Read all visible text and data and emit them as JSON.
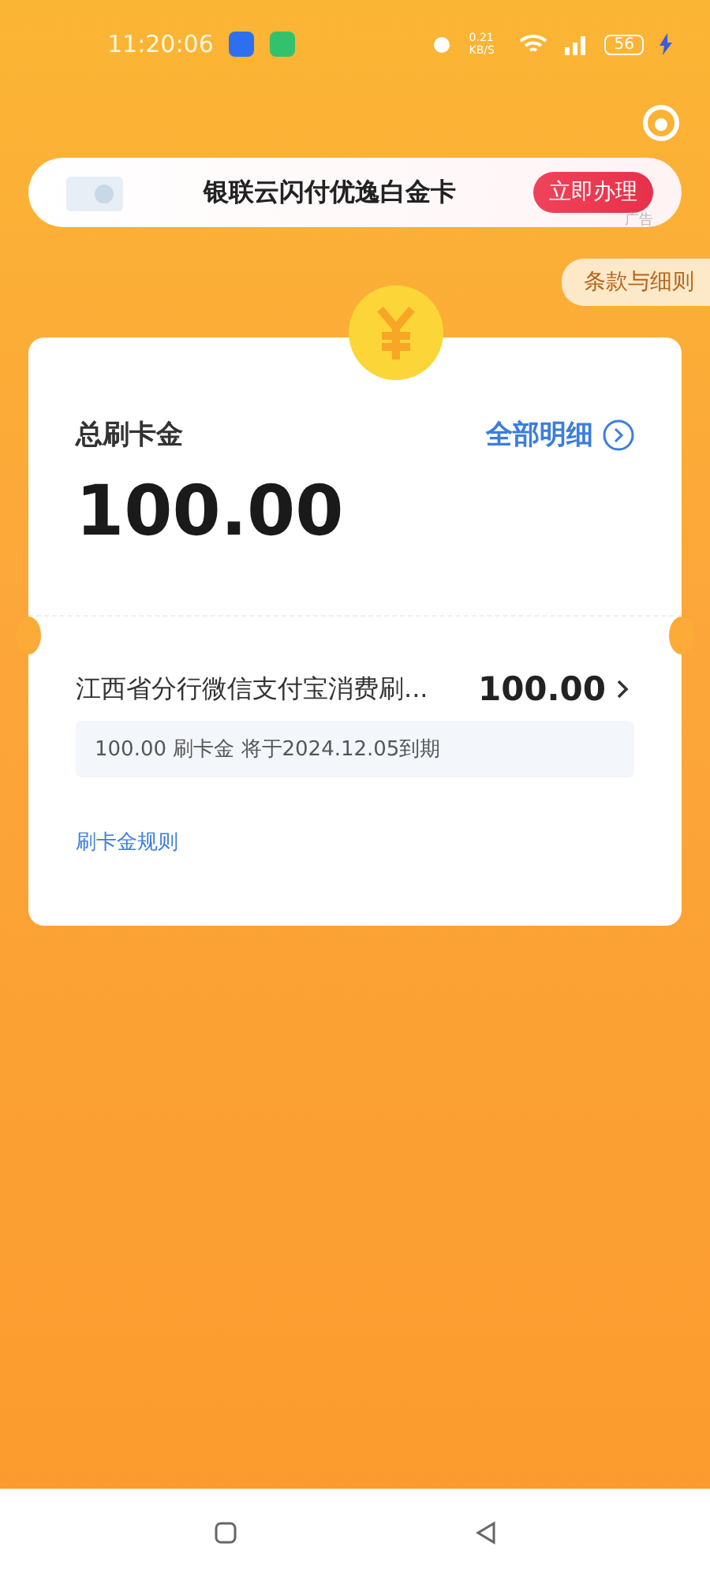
{
  "status_bar": {
    "time": "11:20:06",
    "speed": "0.21 KB/S",
    "battery": "56"
  },
  "banner": {
    "title": "银联云闪付优逸白金卡",
    "button": "立即办理",
    "ad_label": "广告"
  },
  "terms_button": "条款与细则",
  "card": {
    "title": "总刷卡金",
    "detail_link": "全部明细",
    "total": "100.00",
    "items": [
      {
        "name": "江西省分行微信支付宝消费刷...",
        "amount": "100.00",
        "note": "100.00 刷卡金 将于2024.12.05到期"
      }
    ],
    "rules_link": "刷卡金规则"
  }
}
